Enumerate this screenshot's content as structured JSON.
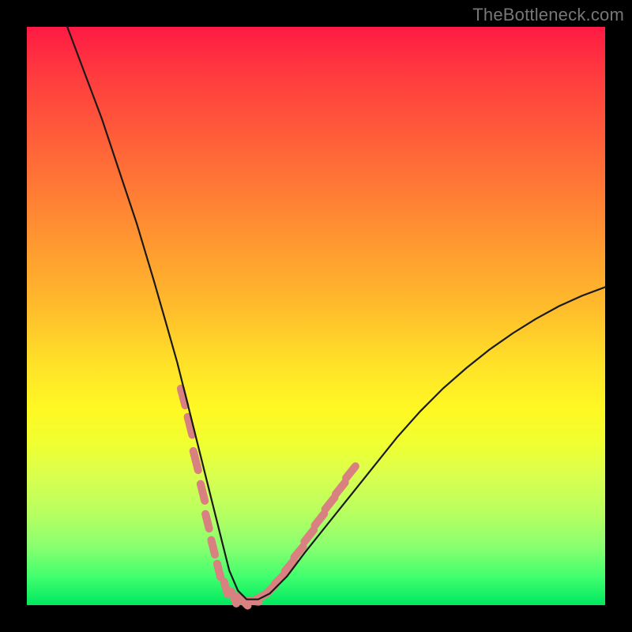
{
  "watermark": "TheBottleneck.com",
  "colors": {
    "frame": "#000000",
    "gradient_top": "#ff1a44",
    "gradient_mid": "#ffe028",
    "gradient_bottom": "#00e860",
    "curve_stroke": "#1a1a1a",
    "dash_stroke": "#d98080"
  },
  "chart_data": {
    "type": "line",
    "title": "",
    "xlabel": "",
    "ylabel": "",
    "xlim": [
      0,
      100
    ],
    "ylim": [
      0,
      100
    ],
    "grid": false,
    "legend": false,
    "series": [
      {
        "name": "bottleneck-curve",
        "x": [
          7,
          10,
          13,
          16,
          19,
          22,
          24,
          26,
          28,
          30,
          32,
          33.5,
          35,
          36.5,
          38,
          40,
          42,
          45,
          48,
          52,
          56,
          60,
          64,
          68,
          72,
          76,
          80,
          84,
          88,
          92,
          96,
          100
        ],
        "y": [
          100,
          92,
          84,
          75,
          66,
          56,
          49,
          42,
          34,
          26,
          18,
          12,
          6,
          2.5,
          1,
          1,
          2,
          5,
          9,
          14,
          19,
          24,
          29,
          33.5,
          37.5,
          41,
          44.2,
          47,
          49.5,
          51.7,
          53.5,
          55
        ]
      }
    ],
    "annotations": [
      {
        "name": "highlight-dashes",
        "description": "salmon dash segments around the curve minimum",
        "segments": [
          {
            "x": 27.0,
            "y": 36,
            "len": 3.0
          },
          {
            "x": 28.2,
            "y": 31,
            "len": 3.2
          },
          {
            "x": 29.2,
            "y": 25,
            "len": 3.4
          },
          {
            "x": 30.4,
            "y": 19.5,
            "len": 3.0
          },
          {
            "x": 31.2,
            "y": 14.5,
            "len": 2.6
          },
          {
            "x": 32.2,
            "y": 10.0,
            "len": 2.6
          },
          {
            "x": 33.2,
            "y": 6.0,
            "len": 2.4
          },
          {
            "x": 34.4,
            "y": 3.0,
            "len": 2.2
          },
          {
            "x": 35.8,
            "y": 1.3,
            "len": 2.2
          },
          {
            "x": 37.4,
            "y": 0.7,
            "len": 2.2
          },
          {
            "x": 39.0,
            "y": 0.7,
            "len": 2.2
          },
          {
            "x": 40.6,
            "y": 1.5,
            "len": 2.2
          },
          {
            "x": 42.2,
            "y": 2.8,
            "len": 2.2
          },
          {
            "x": 43.8,
            "y": 4.6,
            "len": 2.4
          },
          {
            "x": 45.4,
            "y": 6.8,
            "len": 2.4
          },
          {
            "x": 47.0,
            "y": 9.2,
            "len": 2.4
          },
          {
            "x": 48.8,
            "y": 12.0,
            "len": 2.6
          },
          {
            "x": 50.6,
            "y": 14.8,
            "len": 2.6
          },
          {
            "x": 52.4,
            "y": 17.6,
            "len": 2.6
          },
          {
            "x": 54.2,
            "y": 20.2,
            "len": 2.6
          },
          {
            "x": 56.0,
            "y": 23.0,
            "len": 2.6
          }
        ]
      }
    ]
  }
}
